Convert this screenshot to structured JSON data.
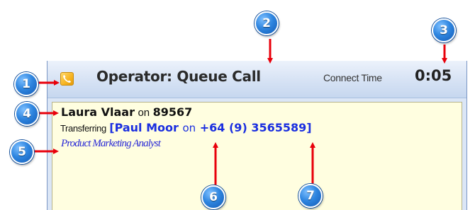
{
  "header": {
    "title": "Operator: Queue Call",
    "connect_time_label": "Connect Time",
    "connect_time_value": "0:05",
    "icon": "phone-icon"
  },
  "call": {
    "caller_name": "Laura Vlaar",
    "on_word": "on",
    "caller_extension": "89567",
    "transfer_status": "Transferring",
    "transfer_target_open": "[",
    "transfer_target_name": "Paul Moor",
    "transfer_target_on": "on",
    "transfer_target_number": "+64 (9) 3565589",
    "transfer_target_close": "]",
    "caller_title": "Product Marketing Analyst"
  },
  "callouts": [
    "1",
    "2",
    "3",
    "4",
    "5",
    "6",
    "7"
  ],
  "colors": {
    "header_bg": "#d6e2f4",
    "body_bg": "#fffee0",
    "transfer_blue": "#1b2fe0",
    "callout_blue": "#2f86e0",
    "arrow_red": "#e8000b"
  }
}
